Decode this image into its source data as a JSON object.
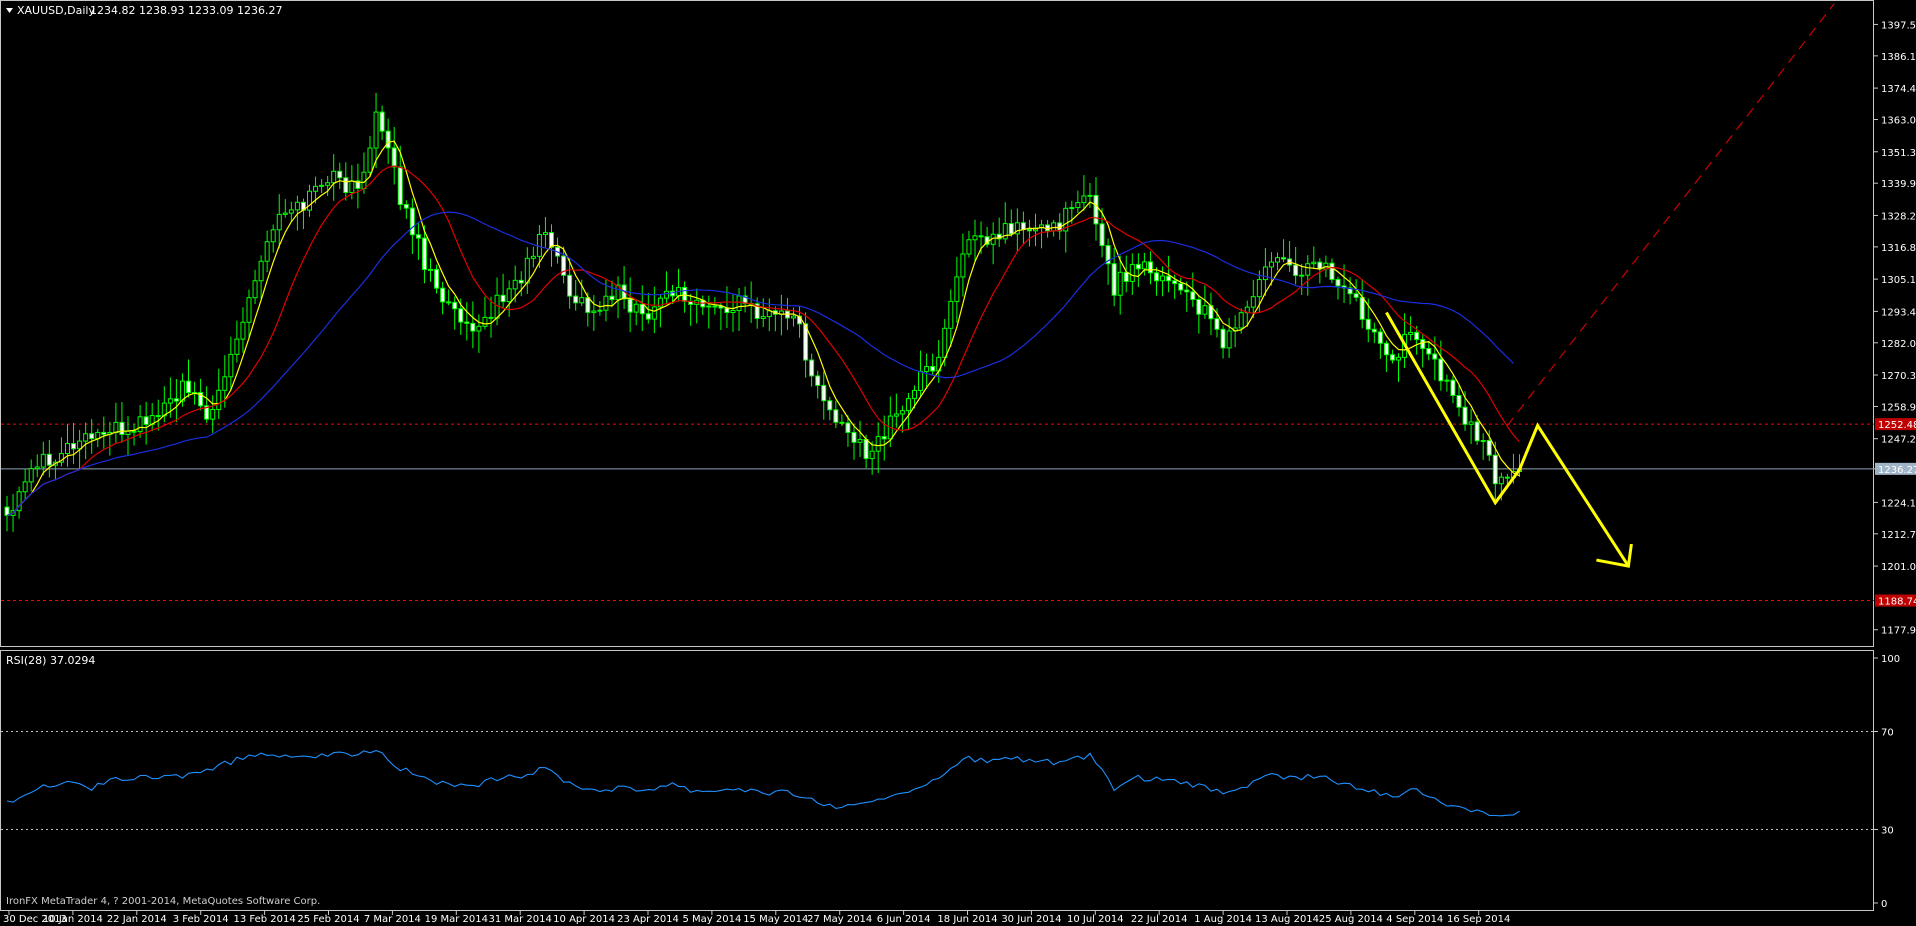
{
  "chart_data": [
    {
      "type": "candlestick",
      "title": "XAUUSD,Daily",
      "ohlc_label": "1234.82 1238.93 1233.09 1236.27",
      "ylim": [
        1172,
        1406
      ],
      "yticks": [
        "1397.50",
        "1386.10",
        "1374.40",
        "1363.00",
        "1351.30",
        "1339.90",
        "1328.20",
        "1316.80",
        "1305.10",
        "1293.40",
        "1282.00",
        "1270.30",
        "1258.90",
        "1247.20",
        "1236.27",
        "1224.10",
        "1212.70",
        "1201.00",
        "1177.90"
      ],
      "xticks": [
        "30 Dec 2013",
        "10 Jan 2014",
        "22 Jan 2014",
        "3 Feb 2014",
        "13 Feb 2014",
        "25 Feb 2014",
        "7 Mar 2014",
        "19 Mar 2014",
        "31 Mar 2014",
        "10 Apr 2014",
        "23 Apr 2014",
        "5 May 2014",
        "15 May 2014",
        "27 May 2014",
        "6 Jun 2014",
        "18 Jun 2014",
        "30 Jun 2014",
        "10 Jul 2014",
        "22 Jul 2014",
        "1 Aug 2014",
        "13 Aug 2014",
        "25 Aug 2014",
        "4 Sep 2014",
        "16 Sep 2014"
      ],
      "close_anchors": [
        [
          0,
          1220
        ],
        [
          4,
          1238
        ],
        [
          9,
          1243
        ],
        [
          14,
          1249
        ],
        [
          19,
          1250
        ],
        [
          24,
          1255
        ],
        [
          29,
          1265
        ],
        [
          34,
          1255
        ],
        [
          40,
          1300
        ],
        [
          44,
          1325
        ],
        [
          49,
          1333
        ],
        [
          53,
          1343
        ],
        [
          58,
          1337
        ],
        [
          61,
          1365
        ],
        [
          65,
          1335
        ],
        [
          69,
          1312
        ],
        [
          73,
          1295
        ],
        [
          77,
          1283
        ],
        [
          80,
          1294
        ],
        [
          85,
          1306
        ],
        [
          89,
          1323
        ],
        [
          93,
          1301
        ],
        [
          97,
          1293
        ],
        [
          101,
          1300
        ],
        [
          105,
          1292
        ],
        [
          110,
          1302
        ],
        [
          113,
          1297
        ],
        [
          117,
          1294
        ],
        [
          121,
          1296
        ],
        [
          125,
          1293
        ],
        [
          130,
          1293
        ],
        [
          134,
          1265
        ],
        [
          138,
          1250
        ],
        [
          142,
          1243
        ],
        [
          146,
          1252
        ],
        [
          150,
          1266
        ],
        [
          154,
          1277
        ],
        [
          158,
          1317
        ],
        [
          162,
          1318
        ],
        [
          166,
          1324
        ],
        [
          170,
          1322
        ],
        [
          174,
          1326
        ],
        [
          179,
          1335
        ],
        [
          183,
          1302
        ],
        [
          187,
          1312
        ],
        [
          191,
          1306
        ],
        [
          194,
          1303
        ],
        [
          198,
          1292
        ],
        [
          201,
          1282
        ],
        [
          205,
          1295
        ],
        [
          209,
          1312
        ],
        [
          213,
          1308
        ],
        [
          217,
          1311
        ],
        [
          221,
          1302
        ],
        [
          225,
          1290
        ],
        [
          229,
          1278
        ],
        [
          233,
          1286
        ],
        [
          237,
          1270
        ],
        [
          241,
          1255
        ],
        [
          244,
          1244
        ],
        [
          246,
          1233
        ],
        [
          250,
          1236
        ]
      ],
      "series": [
        {
          "name": "",
          "color": "#ffff00",
          "period": 5
        },
        {
          "name": "",
          "color": "#e00000",
          "period": 13
        },
        {
          "name": "",
          "color": "#1a2ee0",
          "period": 34
        }
      ],
      "horizontal_lines": [
        {
          "value": 1252.5,
          "label": "1252.48",
          "color": "#ff0000",
          "style": "dashed"
        },
        {
          "value": 1236.27,
          "label": "1236.27",
          "color": "#8fa3b8",
          "style": "solid"
        },
        {
          "value": 1188.5,
          "label": "1188.74",
          "color": "#ff0000",
          "style": "dashed"
        }
      ],
      "annotations": [
        {
          "type": "zigzag-arrow",
          "color": "#ffff00",
          "points": [
            [
              228,
              1293
            ],
            [
              246,
              1224
            ],
            [
              250,
              1236
            ],
            [
              253,
              1252
            ],
            [
              268,
              1201
            ]
          ]
        },
        {
          "type": "trend-line",
          "color": "#cc0000",
          "style": "dashed",
          "points": [
            [
              248,
              1252
            ],
            [
              302,
              1405
            ]
          ]
        }
      ]
    },
    {
      "type": "line",
      "title": "RSI(28) 37.0294",
      "ylim": [
        0,
        100
      ],
      "yticks": [
        "100",
        "70",
        "30",
        "0"
      ],
      "levels": [
        70,
        30
      ],
      "color": "#1e90ff",
      "anchors": [
        [
          0,
          41
        ],
        [
          4,
          46
        ],
        [
          9,
          49
        ],
        [
          14,
          47
        ],
        [
          19,
          51
        ],
        [
          24,
          51
        ],
        [
          29,
          52
        ],
        [
          34,
          55
        ],
        [
          40,
          60
        ],
        [
          44,
          61
        ],
        [
          49,
          60
        ],
        [
          53,
          60
        ],
        [
          58,
          61
        ],
        [
          61,
          63
        ],
        [
          65,
          55
        ],
        [
          69,
          51
        ],
        [
          73,
          48
        ],
        [
          77,
          47
        ],
        [
          80,
          50
        ],
        [
          85,
          52
        ],
        [
          89,
          55
        ],
        [
          93,
          49
        ],
        [
          97,
          46
        ],
        [
          101,
          47
        ],
        [
          105,
          46
        ],
        [
          110,
          49
        ],
        [
          113,
          46
        ],
        [
          117,
          46
        ],
        [
          121,
          47
        ],
        [
          125,
          45
        ],
        [
          130,
          45
        ],
        [
          134,
          41
        ],
        [
          138,
          39
        ],
        [
          142,
          40
        ],
        [
          146,
          44
        ],
        [
          150,
          47
        ],
        [
          154,
          50
        ],
        [
          158,
          59
        ],
        [
          162,
          58
        ],
        [
          166,
          59
        ],
        [
          170,
          58
        ],
        [
          174,
          57
        ],
        [
          179,
          60
        ],
        [
          183,
          47
        ],
        [
          187,
          51
        ],
        [
          191,
          50
        ],
        [
          194,
          49
        ],
        [
          198,
          47
        ],
        [
          201,
          45
        ],
        [
          205,
          48
        ],
        [
          209,
          52
        ],
        [
          213,
          51
        ],
        [
          217,
          52
        ],
        [
          221,
          48
        ],
        [
          225,
          46
        ],
        [
          229,
          44
        ],
        [
          233,
          46
        ],
        [
          237,
          41
        ],
        [
          241,
          39
        ],
        [
          244,
          37
        ],
        [
          246,
          36
        ],
        [
          250,
          37
        ]
      ]
    }
  ],
  "footer": {
    "credit": "IronFX MetaTrader 4, ? 2001-2014, MetaQuotes Software Corp."
  }
}
